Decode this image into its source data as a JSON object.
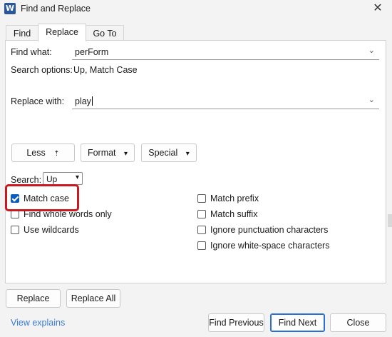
{
  "window": {
    "app_icon": "W",
    "title": "Find and Replace",
    "close_glyph": "✕"
  },
  "tabs": [
    {
      "label": "Find",
      "active": false
    },
    {
      "label": "Replace",
      "active": true
    },
    {
      "label": "Go To",
      "active": false
    }
  ],
  "find": {
    "label": "Find what:",
    "value": "perForm",
    "options_label": "Search options:",
    "options_value": "Up, Match Case"
  },
  "replace": {
    "label": "Replace with:",
    "value": "play"
  },
  "buttons_row": {
    "less": "Less",
    "less_icon": "⇡",
    "format": "Format",
    "special": "Special",
    "dropdown_glyph": "▾"
  },
  "search": {
    "label": "Search:",
    "value": "Up"
  },
  "left_options": [
    {
      "label": "Match case",
      "checked": true
    },
    {
      "label": "Find whole words only",
      "checked": false
    },
    {
      "label": "Use wildcards",
      "checked": false
    }
  ],
  "right_options": [
    {
      "label": "Match prefix",
      "checked": false
    },
    {
      "label": "Match suffix",
      "checked": false
    },
    {
      "label": "Ignore punctuation characters",
      "checked": false
    },
    {
      "label": "Ignore white-space characters",
      "checked": false
    }
  ],
  "bottom": {
    "replace": "Replace",
    "replace_all": "Replace All",
    "view_explains": "View explains",
    "find_previous": "Find Previous",
    "find_next": "Find Next",
    "close": "Close"
  },
  "colors": {
    "highlight": "#c9191e",
    "accent": "#0b5cbe",
    "link": "#3a7bd5"
  }
}
